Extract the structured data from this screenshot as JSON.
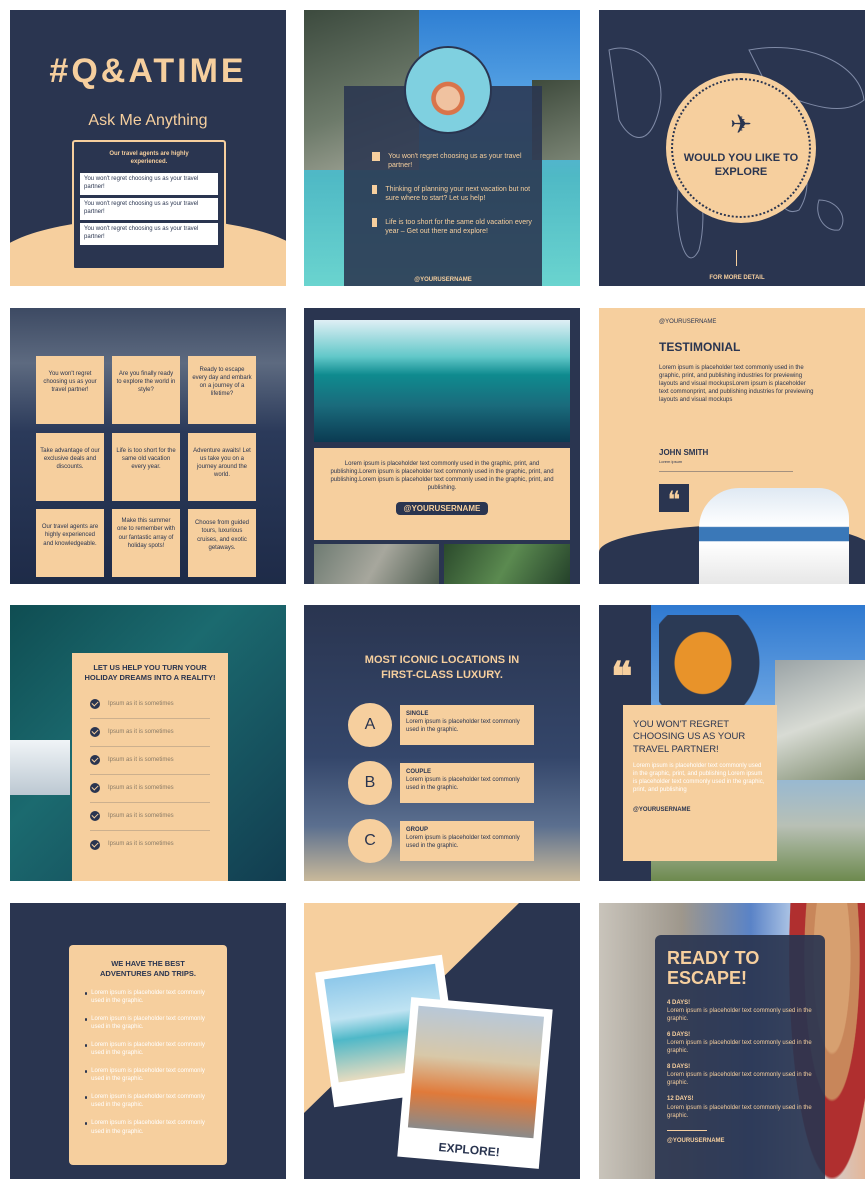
{
  "tile1": {
    "title": "#Q&ATIME",
    "subtitle": "Ask Me Anything",
    "box_heading": "Our travel agents are highly experienced.",
    "items": [
      "You won't regret choosing us as your travel partner!",
      "You won't regret choosing us as your travel partner!",
      "You won't regret choosing us as your travel partner!"
    ]
  },
  "tile2": {
    "items": [
      "You won't regret choosing us as your travel partner!",
      "Thinking of planning your next vacation but not sure where to start? Let us help!",
      "Life is too short for the same old vacation every year – Get out there and explore!"
    ],
    "username": "@YOURUSERNAME"
  },
  "tile3": {
    "circle_text": "WOULD YOU LIKE TO EXPLORE",
    "footer": "FOR MORE DETAIL"
  },
  "tile4": {
    "cells": [
      "You won't regret choosing us as your travel partner!",
      "Are you finally ready to explore the world in style?",
      "Ready to escape every day and embark on a journey of a lifetime?",
      "Take advantage of our exclusive deals and discounts.",
      "Life is too short for the same old vacation every year.",
      "Adventure awaits! Let us take you on a journey around the world.",
      "Our travel agents are highly experienced and knowledgeable.",
      "Make this summer one to remember with our fantastic array of holiday spots!",
      "Choose from guided tours, luxurious cruises, and exotic getaways."
    ]
  },
  "tile5": {
    "body": "Lorem ipsum is placeholder text commonly used in the graphic, print, and publishing.Lorem ipsum is placeholder text commonly used in the graphic, print, and publishing.Lorem ipsum is placeholder text commonly used in the graphic, print, and publishing.",
    "username": "@YOURUSERNAME"
  },
  "tile6": {
    "username": "@YOURUSERNAME",
    "title": "TESTIMONIAL",
    "body": "Lorem ipsum is placeholder text commonly used in the graphic, print, and publishing industries for previewing layouts and visual mockupsLorem ipsum is placeholder text commonprint, and publishing industries for previewing layouts and visual mockups",
    "name": "JOHN SMITH",
    "name_sub": "Lorem ipsum"
  },
  "tile7": {
    "title": "LET US HELP YOU TURN YOUR HOLIDAY DREAMS INTO A REALITY!",
    "items": [
      "Ipsum as it is sometimes",
      "Ipsum as it is sometimes",
      "Ipsum as it is sometimes",
      "Ipsum as it is sometimes",
      "Ipsum as it is sometimes",
      "Ipsum as it is sometimes"
    ]
  },
  "tile8": {
    "title": "MOST ICONIC LOCATIONS IN FIRST-CLASS LUXURY.",
    "options": [
      {
        "letter": "A",
        "label": "SINGLE",
        "text": "Lorem ipsum is placeholder text commonly used in the graphic."
      },
      {
        "letter": "B",
        "label": "COUPLE",
        "text": "Lorem ipsum is placeholder text commonly used in the graphic."
      },
      {
        "letter": "C",
        "label": "GROUP",
        "text": "Lorem ipsum is placeholder text commonly used in the graphic."
      }
    ]
  },
  "tile9": {
    "quote": "❝",
    "title": "YOU WON'T REGRET CHOOSING US AS YOUR TRAVEL PARTNER!",
    "body": "Lorem ipsum is placeholder text commonly used in the graphic, print, and publishing Lorem ipsum is placeholder text commonly used in the graphic, print, and publishing",
    "username": "@YOURUSERNAME"
  },
  "tile10": {
    "title": "WE HAVE THE BEST ADVENTURES AND TRIPS.",
    "items": [
      "Lorem ipsum is placeholder text commonly used in the graphic.",
      "Lorem ipsum is placeholder text commonly used in the graphic.",
      "Lorem ipsum is placeholder text commonly used in the graphic.",
      "Lorem ipsum is placeholder text commonly used in the graphic.",
      "Lorem ipsum is placeholder text commonly used in the graphic.",
      "Lorem ipsum is placeholder text commonly used in the graphic."
    ]
  },
  "tile11": {
    "caption": "EXPLORE!"
  },
  "tile12": {
    "title": "READY TO ESCAPE!",
    "options": [
      {
        "days": "4 DAYS!",
        "text": "Lorem ipsum is placeholder text commonly used in the graphic."
      },
      {
        "days": "6 DAYS!",
        "text": "Lorem ipsum is placeholder text commonly used in the graphic."
      },
      {
        "days": "8 DAYS!",
        "text": "Lorem ipsum is placeholder text commonly used in the graphic."
      },
      {
        "days": "12 DAYS!",
        "text": "Lorem ipsum is placeholder text commonly used in the graphic."
      }
    ],
    "username": "@YOURUSERNAME"
  },
  "colors": {
    "navy": "#2a3550",
    "peach": "#f6cf9e"
  },
  "icons": [
    "plane-icon",
    "quote-icon",
    "check-icon",
    "checkbox-icon"
  ]
}
